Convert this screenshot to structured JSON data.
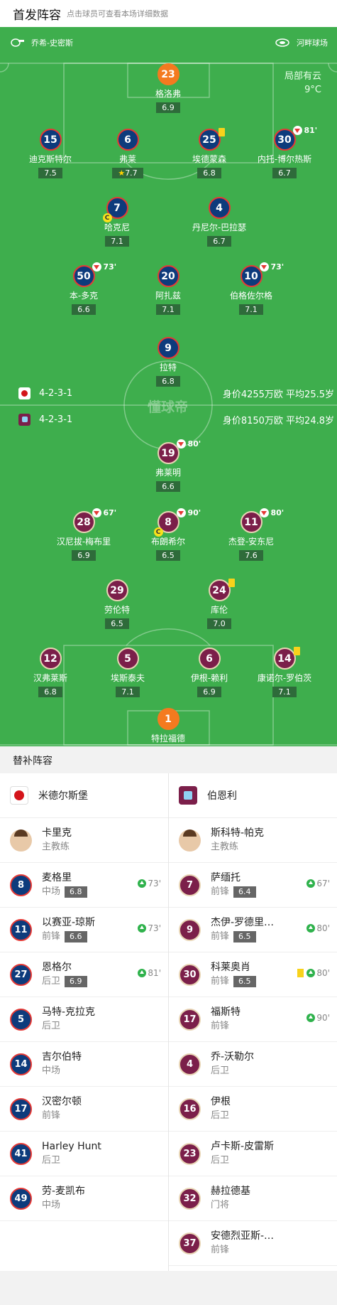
{
  "header": {
    "title": "首发阵容",
    "subtitle": "点击球员可查看本场详细数据"
  },
  "pitch": {
    "referee": "乔希-史密斯",
    "stadium": "河畔球场",
    "weather": "局部有云",
    "temperature": "9°C",
    "watermark": "懂球帝",
    "home_formation": "4-2-3-1",
    "home_value": "身价4255万欧 平均25.5岁",
    "away_formation": "4-2-3-1",
    "away_value": "身价8150万欧 平均24.8岁"
  },
  "home_players": [
    {
      "num": "23",
      "name": "格洛弗",
      "rating": "6.9",
      "gk": true
    },
    {
      "num": "15",
      "name": "迪克斯特尔",
      "rating": "7.5"
    },
    {
      "num": "6",
      "name": "弗莱",
      "rating": "7.7",
      "star": true
    },
    {
      "num": "25",
      "name": "埃德蒙森",
      "rating": "6.8",
      "yellow": true
    },
    {
      "num": "30",
      "name": "内托-博尔热斯",
      "rating": "6.7",
      "sub_min": "81'"
    },
    {
      "num": "7",
      "name": "哈克尼",
      "rating": "7.1",
      "captain": true,
      "captain_label": "C"
    },
    {
      "num": "4",
      "name": "丹尼尔-巴拉瑟",
      "rating": "6.7"
    },
    {
      "num": "50",
      "name": "本-多克",
      "rating": "6.6",
      "sub_min": "73'"
    },
    {
      "num": "20",
      "name": "阿扎兹",
      "rating": "7.1"
    },
    {
      "num": "10",
      "name": "伯格佐尔格",
      "rating": "7.1",
      "sub_min": "73'"
    },
    {
      "num": "9",
      "name": "拉特",
      "rating": "6.8"
    }
  ],
  "away_players": [
    {
      "num": "19",
      "name": "弗莱明",
      "rating": "6.6",
      "sub_min": "80'"
    },
    {
      "num": "28",
      "name": "汉尼拔-梅布里",
      "rating": "6.9",
      "sub_min": "67'"
    },
    {
      "num": "8",
      "name": "布朗希尔",
      "rating": "6.5",
      "sub_min": "90'",
      "captain": true,
      "captain_label": "C"
    },
    {
      "num": "11",
      "name": "杰登-安东尼",
      "rating": "7.6",
      "sub_min": "80'"
    },
    {
      "num": "29",
      "name": "劳伦特",
      "rating": "6.5"
    },
    {
      "num": "24",
      "name": "库伦",
      "rating": "7.0",
      "yellow": true
    },
    {
      "num": "12",
      "name": "汉弗莱斯",
      "rating": "6.8"
    },
    {
      "num": "5",
      "name": "埃斯泰夫",
      "rating": "7.1"
    },
    {
      "num": "6",
      "name": "伊根-赖利",
      "rating": "6.9"
    },
    {
      "num": "14",
      "name": "康诺尔-罗伯茨",
      "rating": "7.1",
      "yellow": true
    },
    {
      "num": "1",
      "name": "特拉福德",
      "rating": "7.2",
      "gk": true
    }
  ],
  "bench": {
    "title": "替补阵容",
    "home_team": "米德尔斯堡",
    "away_team": "伯恩利",
    "home_coach": {
      "name": "卡里克",
      "role": "主教练"
    },
    "away_coach": {
      "name": "斯科特-帕克",
      "role": "主教练"
    },
    "home": [
      {
        "num": "8",
        "name": "麦格里",
        "pos": "中场",
        "rating": "6.8",
        "in": "73'"
      },
      {
        "num": "11",
        "name": "以赛亚-琼斯",
        "pos": "前锋",
        "rating": "6.6",
        "in": "73'"
      },
      {
        "num": "27",
        "name": "恩格尔",
        "pos": "后卫",
        "rating": "6.9",
        "in": "81'"
      },
      {
        "num": "5",
        "name": "马特-克拉克",
        "pos": "后卫"
      },
      {
        "num": "14",
        "name": "吉尔伯特",
        "pos": "中场"
      },
      {
        "num": "17",
        "name": "汉密尔顿",
        "pos": "前锋"
      },
      {
        "num": "41",
        "name": "Harley Hunt",
        "pos": "后卫"
      },
      {
        "num": "49",
        "name": "劳-麦凯布",
        "pos": "中场"
      }
    ],
    "away": [
      {
        "num": "7",
        "name": "萨缅托",
        "pos": "前锋",
        "rating": "6.4",
        "in": "67'"
      },
      {
        "num": "9",
        "name": "杰伊-罗德里…",
        "pos": "前锋",
        "rating": "6.5",
        "in": "80'"
      },
      {
        "num": "30",
        "name": "科莱奥肖",
        "pos": "前锋",
        "rating": "6.5",
        "in": "80'",
        "yellow": true
      },
      {
        "num": "17",
        "name": "福斯特",
        "pos": "前锋",
        "in": "90'"
      },
      {
        "num": "4",
        "name": "乔-沃勒尔",
        "pos": "后卫"
      },
      {
        "num": "16",
        "name": "伊根",
        "pos": "后卫"
      },
      {
        "num": "23",
        "name": "卢卡斯-皮雷斯",
        "pos": "后卫"
      },
      {
        "num": "32",
        "name": "赫拉德基",
        "pos": "门将"
      },
      {
        "num": "37",
        "name": "安德烈亚斯-…",
        "pos": "前锋"
      }
    ]
  },
  "colors": {
    "pitch": "#3eae4d",
    "home": "#0d3b7c",
    "away": "#7b1f4a",
    "gk": "#f47a1f",
    "sub_in": "#2fb24c",
    "yellow": "#f8d21b"
  }
}
